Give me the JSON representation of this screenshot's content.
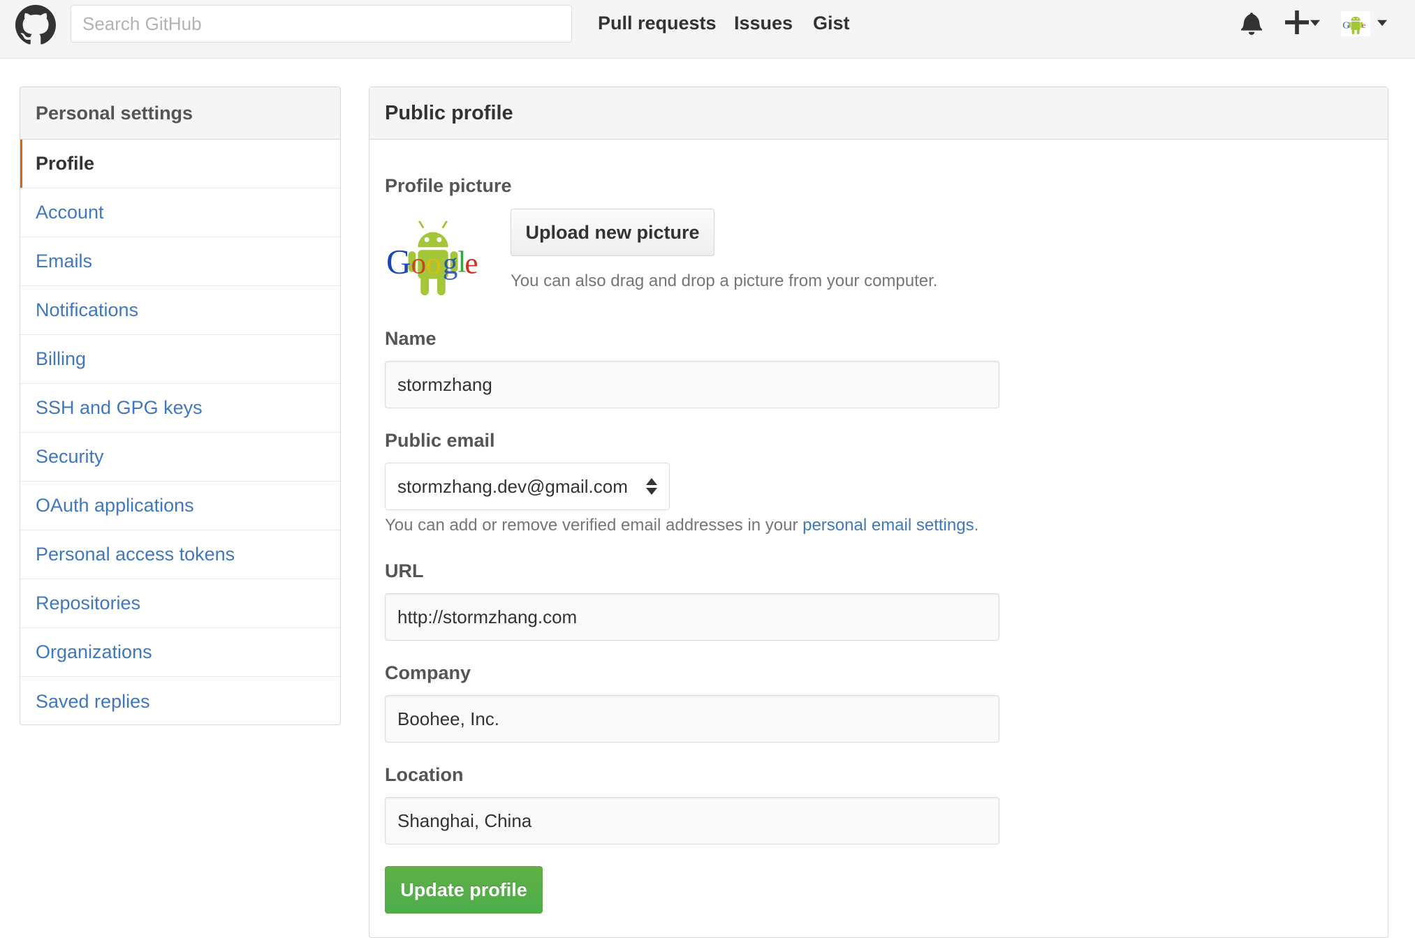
{
  "header": {
    "search_placeholder": "Search GitHub",
    "nav": [
      {
        "label": "Pull requests"
      },
      {
        "label": "Issues"
      },
      {
        "label": "Gist"
      }
    ]
  },
  "sidebar": {
    "title": "Personal settings",
    "items": [
      {
        "label": "Profile",
        "active": true
      },
      {
        "label": "Account"
      },
      {
        "label": "Emails"
      },
      {
        "label": "Notifications"
      },
      {
        "label": "Billing"
      },
      {
        "label": "SSH and GPG keys"
      },
      {
        "label": "Security"
      },
      {
        "label": "OAuth applications"
      },
      {
        "label": "Personal access tokens"
      },
      {
        "label": "Repositories"
      },
      {
        "label": "Organizations"
      },
      {
        "label": "Saved replies"
      }
    ]
  },
  "profile": {
    "title": "Public profile",
    "picture_label": "Profile picture",
    "upload_label": "Upload new picture",
    "drag_note": "You can also drag and drop a picture from your computer.",
    "name_label": "Name",
    "name_value": "stormzhang",
    "email_label": "Public email",
    "email_value": "stormzhang.dev@gmail.com",
    "email_note_prefix": "You can add or remove verified email addresses in your ",
    "email_note_link": "personal email settings",
    "email_note_suffix": ".",
    "url_label": "URL",
    "url_value": "http://stormzhang.com",
    "company_label": "Company",
    "company_value": "Boohee, Inc.",
    "location_label": "Location",
    "location_value": "Shanghai, China",
    "update_label": "Update profile"
  },
  "colors": {
    "link": "#4078c0",
    "active_indicator": "#d26911",
    "primary_button": "#60b044"
  },
  "icons": {
    "logo": "octocat-icon",
    "bell": "bell-icon",
    "plus": "plus-icon",
    "caret": "caret-down-icon",
    "select": "select-arrows-icon"
  }
}
